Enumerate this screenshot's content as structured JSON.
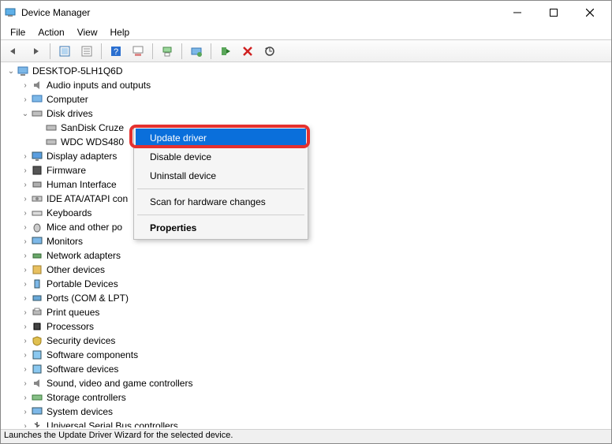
{
  "window": {
    "title": "Device Manager"
  },
  "menubar": [
    "File",
    "Action",
    "View",
    "Help"
  ],
  "toolbar_icons": [
    "back",
    "forward",
    "show-hidden",
    "properties",
    "help",
    "refresh",
    "print",
    "monitor",
    "update",
    "uninstall",
    "scan"
  ],
  "tree": {
    "root": "DESKTOP-5LH1Q6D",
    "nodes": [
      {
        "label": "Audio inputs and outputs",
        "exp": ">",
        "icon": "audio"
      },
      {
        "label": "Computer",
        "exp": ">",
        "icon": "computer"
      },
      {
        "label": "Disk drives",
        "exp": "v",
        "icon": "disk",
        "children": [
          {
            "label": "SanDisk Cruze",
            "icon": "disk"
          },
          {
            "label": "WDC WDS480",
            "icon": "disk"
          }
        ]
      },
      {
        "label": "Display adapters",
        "exp": ">",
        "icon": "display"
      },
      {
        "label": "Firmware",
        "exp": ">",
        "icon": "firmware"
      },
      {
        "label": "Human Interface",
        "exp": ">",
        "icon": "hid"
      },
      {
        "label": "IDE ATA/ATAPI con",
        "exp": ">",
        "icon": "ide"
      },
      {
        "label": "Keyboards",
        "exp": ">",
        "icon": "keyboard"
      },
      {
        "label": "Mice and other po",
        "exp": ">",
        "icon": "mouse"
      },
      {
        "label": "Monitors",
        "exp": ">",
        "icon": "monitor"
      },
      {
        "label": "Network adapters",
        "exp": ">",
        "icon": "network"
      },
      {
        "label": "Other devices",
        "exp": ">",
        "icon": "other"
      },
      {
        "label": "Portable Devices",
        "exp": ">",
        "icon": "portable"
      },
      {
        "label": "Ports (COM & LPT)",
        "exp": ">",
        "icon": "ports"
      },
      {
        "label": "Print queues",
        "exp": ">",
        "icon": "print"
      },
      {
        "label": "Processors",
        "exp": ">",
        "icon": "cpu"
      },
      {
        "label": "Security devices",
        "exp": ">",
        "icon": "security"
      },
      {
        "label": "Software components",
        "exp": ">",
        "icon": "sw"
      },
      {
        "label": "Software devices",
        "exp": ">",
        "icon": "sw"
      },
      {
        "label": "Sound, video and game controllers",
        "exp": ">",
        "icon": "sound"
      },
      {
        "label": "Storage controllers",
        "exp": ">",
        "icon": "storage"
      },
      {
        "label": "System devices",
        "exp": ">",
        "icon": "system"
      },
      {
        "label": "Universal Serial Bus controllers",
        "exp": ">",
        "icon": "usb"
      }
    ]
  },
  "context_menu": {
    "items": [
      {
        "label": "Update driver",
        "highlight": true
      },
      {
        "label": "Disable device"
      },
      {
        "label": "Uninstall device"
      },
      {
        "sep": true
      },
      {
        "label": "Scan for hardware changes"
      },
      {
        "sep": true
      },
      {
        "label": "Properties",
        "bold": true
      }
    ]
  },
  "statusbar": "Launches the Update Driver Wizard for the selected device."
}
